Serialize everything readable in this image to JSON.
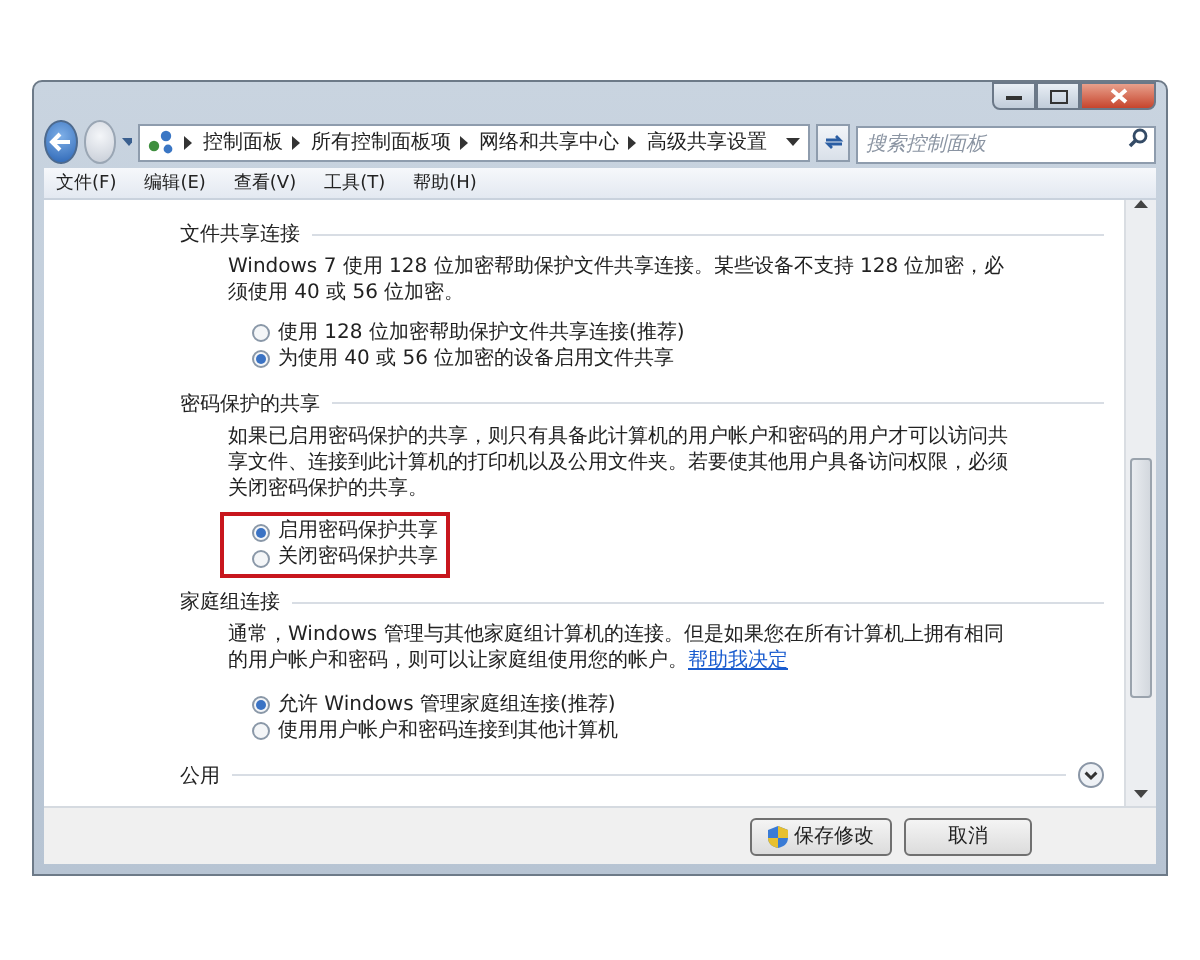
{
  "address": {
    "crumbs": [
      "控制面板",
      "所有控制面板项",
      "网络和共享中心",
      "高级共享设置"
    ]
  },
  "search": {
    "placeholder": "搜索控制面板"
  },
  "menu": [
    "文件(F)",
    "编辑(E)",
    "查看(V)",
    "工具(T)",
    "帮助(H)"
  ],
  "sections": [
    {
      "title": "文件共享连接",
      "expanded": true,
      "highlighted": false,
      "description": "Windows 7 使用 128 位加密帮助保护文件共享连接。某些设备不支持 128 位加密，必须使用 40 或 56 位加密。",
      "options": [
        {
          "label": "使用 128 位加密帮助保护文件共享连接(推荐)",
          "selected": false
        },
        {
          "label": "为使用 40 或 56 位加密的设备启用文件共享",
          "selected": true
        }
      ]
    },
    {
      "title": "密码保护的共享",
      "expanded": true,
      "highlighted": true,
      "description": "如果已启用密码保护的共享，则只有具备此计算机的用户帐户和密码的用户才可以访问共享文件、连接到此计算机的打印机以及公用文件夹。若要使其他用户具备访问权限，必须关闭密码保护的共享。",
      "options": [
        {
          "label": "启用密码保护共享",
          "selected": true
        },
        {
          "label": "关闭密码保护共享",
          "selected": false
        }
      ]
    },
    {
      "title": "家庭组连接",
      "expanded": true,
      "highlighted": false,
      "description": "通常，Windows 管理与其他家庭组计算机的连接。但是如果您在所有计算机上拥有相同的用户帐户和密码，则可以让家庭组使用您的帐户。",
      "link": "帮助我决定",
      "options": [
        {
          "label": "允许 Windows 管理家庭组连接(推荐)",
          "selected": true
        },
        {
          "label": "使用用户帐户和密码连接到其他计算机",
          "selected": false
        }
      ]
    },
    {
      "title": "公用",
      "expanded": false
    }
  ],
  "buttons": [
    {
      "label": "保存修改",
      "kind": "shield"
    },
    {
      "label": "取消",
      "kind": "plain"
    }
  ]
}
